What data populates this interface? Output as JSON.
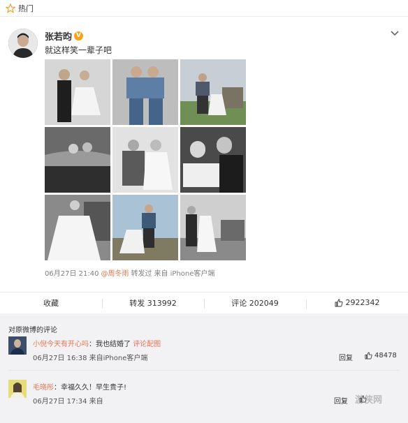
{
  "topbar": {
    "label": "热门",
    "icon": "star-icon"
  },
  "post": {
    "username": "张若昀",
    "verified_badge": "V",
    "text": "就这样笑一辈子吧",
    "meta": {
      "time": "06月27日 21:40",
      "via_user": "@周冬雨",
      "repost_text": "转发过",
      "source": "来自 iPhone客户端"
    }
  },
  "actions": {
    "favorite": "收藏",
    "repost": "转发 313992",
    "comment": "评论 202049",
    "likes": "2922342"
  },
  "comments": {
    "header": "对原微博的评论",
    "items": [
      {
        "user": "小倪今天有开心吗",
        "sep": "：",
        "text": "我也结婚了",
        "link": "评论配图",
        "meta": "06月27日 16:38 来自iPhone客户端",
        "reply": "回复",
        "likes": "48478"
      },
      {
        "user": "毛晓彤",
        "sep": "：",
        "text": "幸福久久！早生贵子!",
        "meta": "06月27日 17:34 来自",
        "reply": "回复",
        "likes": ""
      }
    ]
  },
  "watermark": "游侠网",
  "colors": {
    "accent": "#eb7350",
    "badge": "#f7a21b",
    "comment_bg": "#f2f2f5"
  }
}
